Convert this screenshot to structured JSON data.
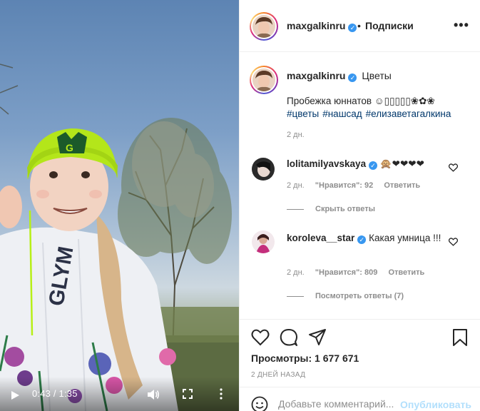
{
  "post": {
    "username": "maxgalkinru",
    "follow_separator": "•",
    "follow_label": "Подписки",
    "more_label": "•••"
  },
  "caption": {
    "username": "maxgalkinru",
    "location_text": "Цветы",
    "text": "Пробежка юннатов ☺▯▯▯▯▯❀✿❀",
    "hashtags": [
      "#цветы",
      "#нашсад",
      "#елизаветагалкина"
    ],
    "time": "2 дн."
  },
  "comments": [
    {
      "username": "lolitamilyavskaya",
      "text": "🙊❤❤❤❤",
      "time": "2 дн.",
      "likes": "\"Нравится\": 92",
      "reply": "Ответить",
      "replies_toggle": "Скрыть ответы"
    },
    {
      "username": "koroleva__star",
      "text": "Какая умница !!!",
      "time": "2 дн.",
      "likes": "\"Нравится\": 809",
      "reply": "Ответить",
      "replies_toggle": "Посмотреть ответы (7)"
    }
  ],
  "stats": {
    "views": "Просмотры: 1 677 671",
    "posted": "2 ДНЕЙ НАЗАД"
  },
  "add_comment": {
    "placeholder": "Добавьте комментарий...",
    "publish": "Опубликовать"
  },
  "video": {
    "time": "0:43 / 1:35",
    "progress": 0.45
  },
  "colors": {
    "verified": "#3897f0",
    "link": "#00376b",
    "muted": "#8e8e8e",
    "publish_disabled": "#b2dffc"
  },
  "icons": {
    "like": "heart-icon",
    "comment": "comment-icon",
    "share": "share-icon",
    "save": "bookmark-icon",
    "emoji": "smiley-icon"
  }
}
